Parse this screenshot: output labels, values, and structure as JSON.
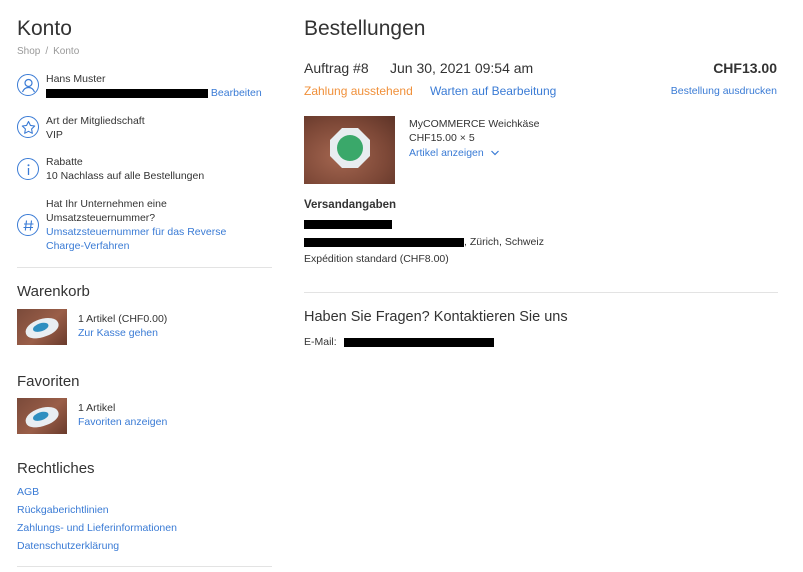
{
  "account": {
    "title": "Konto",
    "breadcrumb": [
      "Shop",
      "Konto"
    ],
    "breadcrumb_sep": "/",
    "profile": {
      "name": "Hans Muster",
      "edit_label": "Bearbeiten"
    },
    "membership": {
      "title": "Art der Mitgliedschaft",
      "value": "VIP"
    },
    "discounts": {
      "title": "Rabatte",
      "value": "10 Nachlass auf alle Bestellungen"
    },
    "vat": {
      "title": "Hat Ihr Unternehmen eine Umsatzsteuernummer?",
      "link": "Umsatzsteuernummer für das Reverse Charge-Verfahren"
    }
  },
  "cart": {
    "title": "Warenkorb",
    "summary": "1 Artikel (CHF0.00)",
    "link": "Zur Kasse gehen"
  },
  "favorites": {
    "title": "Favoriten",
    "summary": "1 Artikel",
    "link": "Favoriten anzeigen"
  },
  "legal": {
    "title": "Rechtliches",
    "links": [
      "AGB",
      "Rückgaberichtlinien",
      "Zahlungs- und Lieferinformationen",
      "Datenschutzerklärung"
    ]
  },
  "orders": {
    "title": "Bestellungen",
    "order_number": "Auftrag #8",
    "date": "Jun 30, 2021 09:54 am",
    "total": "CHF13.00",
    "payment_status": "Zahlung ausstehend",
    "processing_status": "Warten auf Bearbeitung",
    "print_label": "Bestellung ausdrucken",
    "product": {
      "name": "MyCOMMERCE Weichkäse",
      "price": "CHF15.00 × 5",
      "link": "Artikel anzeigen"
    },
    "shipping": {
      "title": "Versandangaben",
      "address_suffix": ", Zürich, Schweiz",
      "method": "Expédition standard (CHF8.00)"
    },
    "questions": {
      "title": "Haben Sie Fragen? Kontaktieren Sie uns",
      "email_label": "E-Mail:"
    }
  },
  "colors": {
    "link": "#3a7bd5",
    "pending": "#f0903a",
    "text": "#333333"
  },
  "icons": [
    "user-icon",
    "star-icon",
    "info-icon",
    "hash-icon",
    "chevron-down-icon"
  ]
}
